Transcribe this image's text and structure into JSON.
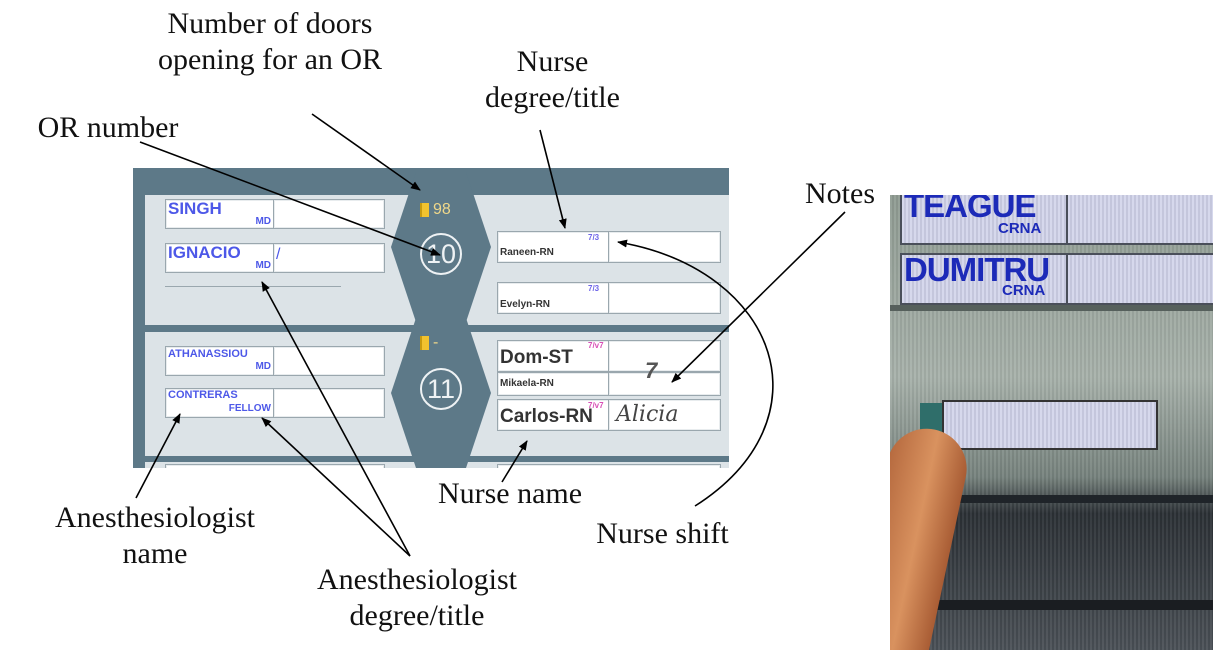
{
  "callouts": {
    "doors": "Number of doors opening for an OR",
    "or_number": "OR number",
    "nurse_degree": "Nurse degree/title",
    "notes": "Notes",
    "anes_name": "Anesthesiologist name",
    "anes_degree": "Anesthesiologist degree/title",
    "nurse_name": "Nurse name",
    "nurse_shift": "Nurse shift"
  },
  "rooms": [
    {
      "or_number": "10",
      "door_count": "98",
      "anesthesiologists": [
        {
          "name": "SINGH",
          "degree": "MD",
          "note": ""
        },
        {
          "name": "IGNACIO",
          "degree": "MD",
          "note": "/"
        }
      ],
      "nurses": [
        {
          "name": "Raneen-RN",
          "shift": "7/3",
          "note": ""
        },
        {
          "name": "Evelyn-RN",
          "shift": "7/3",
          "note": ""
        }
      ]
    },
    {
      "or_number": "11",
      "door_count": "-",
      "anesthesiologists": [
        {
          "name": "ATHANASSIOU",
          "degree": "MD"
        },
        {
          "name": "CONTRERAS",
          "degree": "FELLOW"
        }
      ],
      "nurses": [
        {
          "name": "Dom-ST",
          "shift": "7/v7",
          "note": "7"
        },
        {
          "name": "Mikaela-RN",
          "shift": ""
        },
        {
          "name": "Carlos-RN",
          "shift": "7/v7",
          "note": "Alicia"
        }
      ]
    }
  ],
  "photo": {
    "entries": [
      {
        "name": "TEAGUE",
        "degree": "CRNA"
      },
      {
        "name": "DUMITRU",
        "degree": "CRNA"
      }
    ]
  },
  "colors": {
    "board_frame": "#5d7988",
    "anes_text": "#4d58e8",
    "door_icon": "#f2c22e",
    "shift_pink": "#d94fb6"
  }
}
